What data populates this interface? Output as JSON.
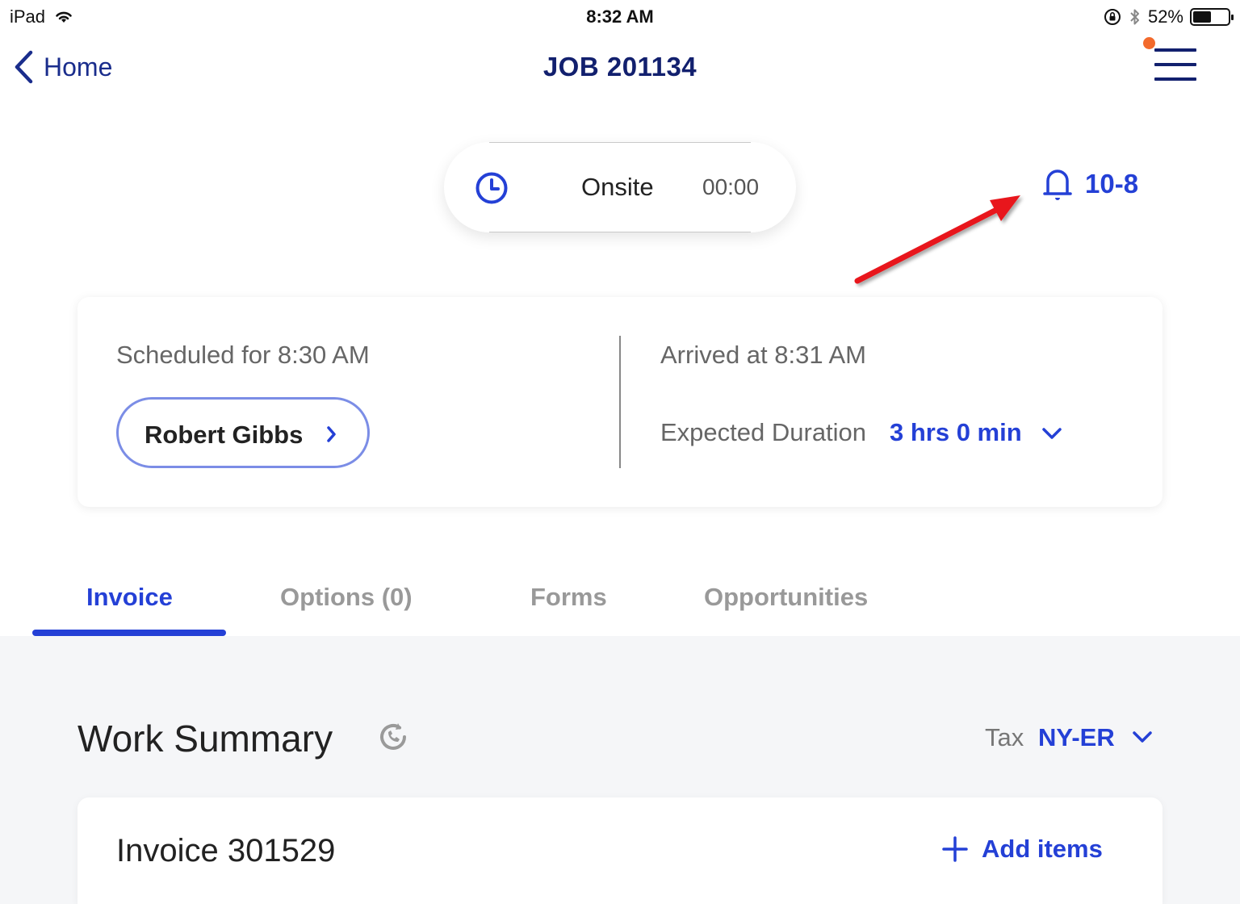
{
  "status_bar": {
    "device": "iPad",
    "time": "8:32 AM",
    "battery": "52%",
    "battery_level": 0.52
  },
  "nav": {
    "back_label": "Home",
    "title": "JOB 201134"
  },
  "onsite": {
    "label": "Onsite",
    "timer": "00:00"
  },
  "notification": {
    "label": "10-8"
  },
  "schedule": {
    "scheduled": "Scheduled for 8:30 AM",
    "customer": "Robert Gibbs",
    "arrived": "Arrived at 8:31 AM",
    "duration_label": "Expected Duration",
    "duration_value": "3 hrs 0 min"
  },
  "tabs": [
    {
      "label": "Invoice",
      "active": true
    },
    {
      "label": "Options (0)",
      "active": false
    },
    {
      "label": "Forms",
      "active": false
    },
    {
      "label": "Opportunities",
      "active": false
    }
  ],
  "work_summary": {
    "title": "Work Summary",
    "tax_label": "Tax",
    "tax_value": "NY-ER"
  },
  "invoice": {
    "title": "Invoice 301529",
    "add_label": "Add items"
  },
  "colors": {
    "accent": "#2440d6",
    "navy": "#12206e",
    "annotation": "#e8141b",
    "notification_dot": "#f36a2c"
  }
}
